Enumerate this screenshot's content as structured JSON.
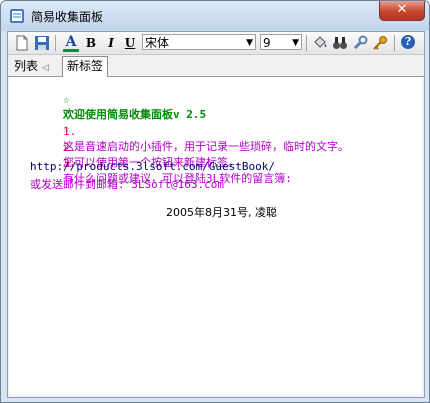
{
  "window": {
    "title": "简易收集面板",
    "close_glyph": "✕"
  },
  "toolbar": {
    "font_name": "宋体",
    "font_size": "9",
    "bold": "B",
    "italic": "I",
    "underline": "U",
    "font_color_letter": "A",
    "help_glyph": "?"
  },
  "tabs": {
    "list": "列表",
    "list_arrow": "◁",
    "new": "新标签"
  },
  "note": {
    "header_star_left": "☆",
    "header_text": "欢迎使用简易收集面板v 2.5",
    "header_star_right": "☆",
    "items": [
      {
        "num": "1.",
        "text": "这是音速启动的小插件，用于记录一些琐碎，临时的文字。"
      },
      {
        "num": "2.",
        "text": "您可以使用第一个按钮来新建标签。"
      },
      {
        "num": "3.",
        "text": "有什么问题或建议，可以登陆3L软件的留言簿:"
      }
    ],
    "url_line": "http://products.3lsoft.com/GuestBook/",
    "email_line": "或发送邮件到邮箱: 3LSoft@163.com",
    "signature": "2005年8月31号, 凌聪"
  },
  "colors": {
    "titlebar": "#c2d5ec",
    "header_green": "#008a00",
    "number_pink": "#d7006e",
    "text_purple": "#b000c8",
    "url_navy": "#00006e"
  }
}
